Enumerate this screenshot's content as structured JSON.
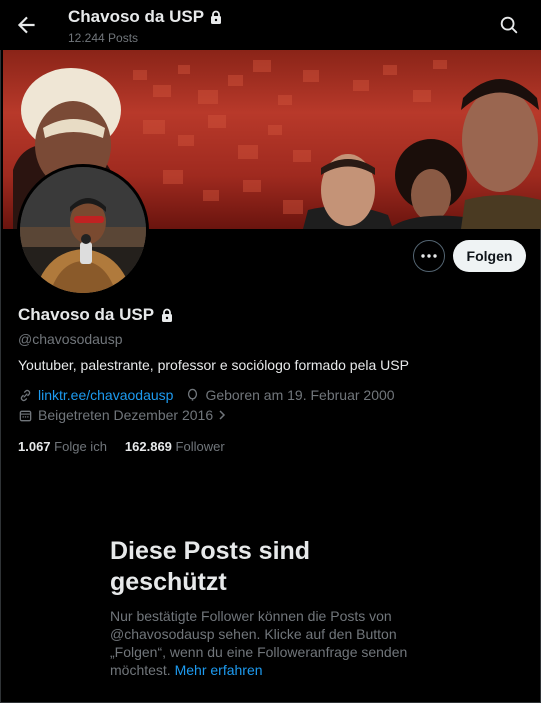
{
  "header": {
    "title": "Chavoso da USP",
    "posts_count": "12.244 Posts",
    "back_icon": "arrow-left-icon",
    "search_icon": "search-icon"
  },
  "profile": {
    "name": "Chavoso da USP",
    "handle": "@chavosodausp",
    "bio": "Youtuber, palestrante, professor e sociólogo formado pela USP",
    "link": "linktr.ee/chavaodausp",
    "birthday": "Geboren am 19. Februar 2000",
    "joined": "Beigetreten Dezember 2016",
    "following_count": "1.067",
    "following_label": "Folge ich",
    "followers_count": "162.869",
    "followers_label": "Follower",
    "follow_button": "Folgen"
  },
  "protected": {
    "title": "Diese Posts sind geschützt",
    "text": "Nur bestätigte Follower können die Posts von @chavosodausp sehen. Klicke auf den Button „Folgen“, wenn du eine Followeranfrage senden möchtest.",
    "learn_more": "Mehr erfahren"
  },
  "colors": {
    "background": "#000000",
    "link": "#1d9bf0",
    "muted": "#71767b",
    "text": "#e7e9ea"
  }
}
